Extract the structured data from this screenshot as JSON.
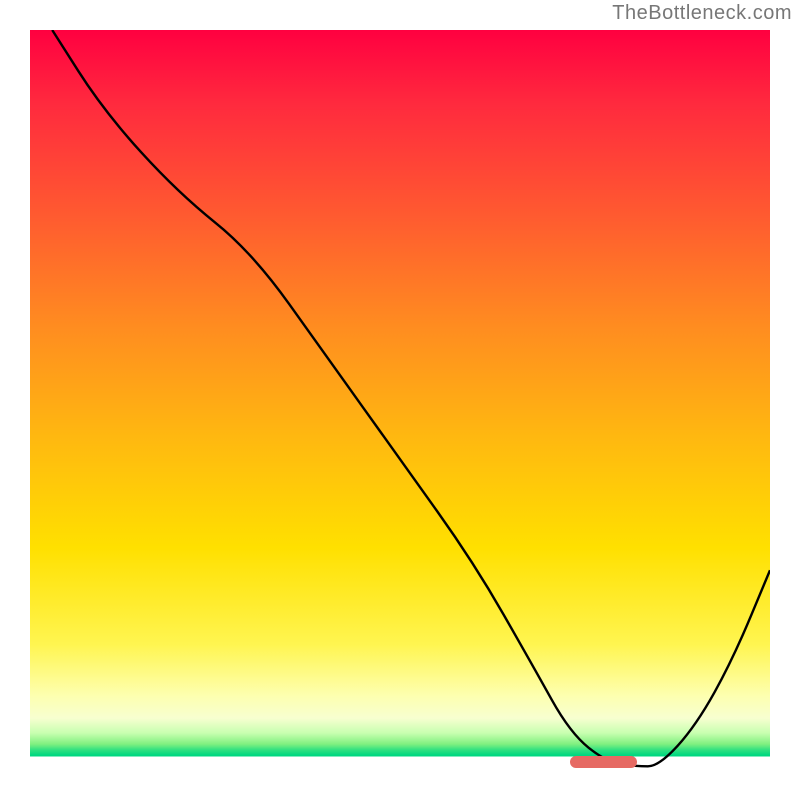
{
  "watermark": "TheBottleneck.com",
  "chart_data": {
    "type": "line",
    "title": "",
    "xlabel": "",
    "ylabel": "",
    "xlim": [
      0,
      100
    ],
    "ylim": [
      0,
      100
    ],
    "grid": false,
    "series": [
      {
        "name": "curve",
        "x": [
          3,
          10,
          20,
          30,
          40,
          50,
          60,
          68,
          73,
          78,
          82,
          85,
          90,
          95,
          100
        ],
        "y": [
          100,
          89,
          78,
          70,
          56,
          42,
          28,
          14,
          5,
          1,
          0.5,
          0.5,
          6,
          15,
          27
        ]
      }
    ],
    "annotations": [
      {
        "name": "optimal-marker",
        "x_start": 73,
        "x_end": 82,
        "y": 1.1,
        "color": "#e66a63"
      }
    ],
    "background": {
      "type": "vertical-gradient",
      "stops": [
        {
          "pos": 0,
          "color": "#ff0040"
        },
        {
          "pos": 0.55,
          "color": "#ffb810"
        },
        {
          "pos": 0.83,
          "color": "#fff550"
        },
        {
          "pos": 0.97,
          "color": "#00d880"
        },
        {
          "pos": 1.0,
          "color": "#ffffff"
        }
      ]
    }
  }
}
